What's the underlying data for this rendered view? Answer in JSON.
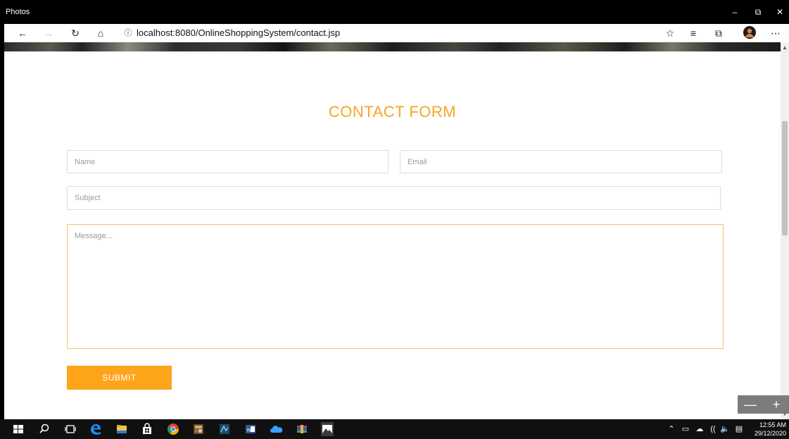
{
  "window": {
    "title": "Photos",
    "controls": {
      "minimize": "–",
      "restore": "⧉",
      "close": "✕"
    }
  },
  "browser": {
    "url": "localhost:8080/OnlineShoppingSystem/contact.jsp",
    "icons": [
      "back-arrow-icon",
      "forward-arrow-icon",
      "refresh-icon",
      "home-icon",
      "info-icon",
      "favorite-star-icon",
      "favorites-list-icon",
      "collections-icon",
      "profile-avatar-icon",
      "more-menu-icon"
    ]
  },
  "page": {
    "title": "CONTACT FORM",
    "name_placeholder": "Name",
    "email_placeholder": "Email",
    "subject_placeholder": "Subject",
    "message_placeholder": "Message...",
    "submit_label": "SUBMIT"
  },
  "zoom": {
    "minus": "—",
    "plus": "+"
  },
  "taskbar": {
    "time": "12:55 AM",
    "date": "29/12/2020"
  },
  "colors": {
    "accent": "#f5a623",
    "button": "#ffa51a",
    "taskbar": "#101010"
  }
}
